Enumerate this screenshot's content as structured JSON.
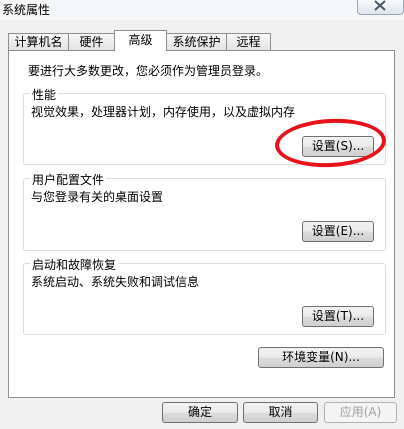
{
  "window": {
    "title": "系统属性",
    "close_icon": "close-icon"
  },
  "tabs": [
    {
      "label": "计算机名"
    },
    {
      "label": "硬件"
    },
    {
      "label": "高级",
      "active": true
    },
    {
      "label": "系统保护"
    },
    {
      "label": "远程"
    }
  ],
  "advanced": {
    "admin_note": "要进行大多数更改，您必须作为管理员登录。",
    "performance": {
      "title": "性能",
      "description": "视觉效果，处理器计划，内存使用，以及虚拟内存",
      "settings_label": "设置(S)..."
    },
    "user_profiles": {
      "title": "用户配置文件",
      "description": "与您登录有关的桌面设置",
      "settings_label": "设置(E)..."
    },
    "startup_recovery": {
      "title": "启动和故障恢复",
      "description": "系统启动、系统失败和调试信息",
      "settings_label": "设置(T)..."
    },
    "env_vars_label": "环境变量(N)..."
  },
  "footer": {
    "ok_label": "确定",
    "cancel_label": "取消",
    "apply_label": "应用(A)"
  },
  "annotation": {
    "color": "#e8121a"
  }
}
